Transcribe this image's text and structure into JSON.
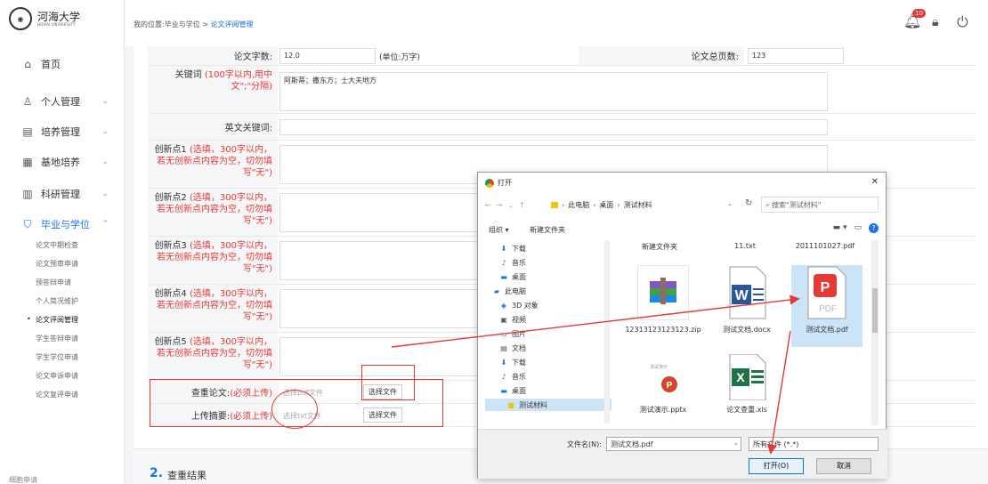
{
  "logo": {
    "name": "河海大学",
    "sub": "HOHAI UNIVERSITY"
  },
  "sidebar": {
    "items": [
      {
        "label": "首页",
        "icon": "home-icon"
      },
      {
        "label": "个人管理",
        "icon": "user-icon"
      },
      {
        "label": "培养管理",
        "icon": "chart-icon"
      },
      {
        "label": "基地培养",
        "icon": "grid-icon"
      },
      {
        "label": "科研管理",
        "icon": "bar-chart-icon"
      },
      {
        "label": "毕业与学位",
        "icon": "graduation-cap-icon"
      }
    ],
    "subitems": [
      "论文中期检查",
      "论文预审申请",
      "预答辩申请",
      "个人简况维护",
      "论文评阅管理",
      "学生答辩申请",
      "学生学位申请",
      "论文申诉申请",
      "论文复评申请"
    ],
    "bottom_text": "细胞申请"
  },
  "header": {
    "breadcrumb_prefix": "我的位置:毕业与学位 >",
    "breadcrumb_current": "论文评阅管理",
    "notification_count": "10"
  },
  "form": {
    "word_count_label": "论文字数:",
    "word_count_value": "12.0",
    "word_count_unit": "(单位:万字)",
    "total_pages_label": "论文总页数:",
    "total_pages_value": "123",
    "keywords_label": "关键词",
    "keywords_hint": "(100字以内,用中文\";\"分隔)",
    "keywords_value": "阿斯蒂；撒东方；士大夫地方",
    "en_keywords_label": "英文关键词:",
    "innovations": [
      {
        "label": "创新点1",
        "hint": "(选填，300字以内，若无创新点内容为空，切勿填写\"无\")"
      },
      {
        "label": "创新点2",
        "hint": "(选填，300字以内，若无创新点内容为空，切勿填写\"无\")"
      },
      {
        "label": "创新点3",
        "hint": "(选填，300字以内，若无创新点内容为空，切勿填写\"无\")"
      },
      {
        "label": "创新点4",
        "hint": "(选填，300字以内，若无创新点内容为空，切勿填写\"无\")"
      },
      {
        "label": "创新点5",
        "hint": "(选填，300字以内，若无创新点内容为空，切勿填写\"无\")"
      }
    ],
    "check_paper_label": "查重论文:",
    "check_paper_req": "(必须上传)",
    "check_paper_placeholder": "选择pdf文件",
    "abstract_label": "上传摘要:",
    "abstract_req": "(必须上传)",
    "abstract_placeholder": "选择txt文件",
    "choose_file": "选择文件"
  },
  "section2": {
    "num": "2.",
    "title": "查重结果"
  },
  "dialog": {
    "title": "打开",
    "address": [
      "此电脑",
      "桌面",
      "测试材料"
    ],
    "search_placeholder": "搜索\"测试材料\"",
    "organize": "组织 ▾",
    "new_folder": "新建文件夹",
    "tree": [
      {
        "label": "下载",
        "icon": "download-icon"
      },
      {
        "label": "音乐",
        "icon": "music-icon"
      },
      {
        "label": "桌面",
        "icon": "desktop-icon"
      },
      {
        "label": "此电脑",
        "icon": "computer-icon"
      },
      {
        "label": "3D 对象",
        "icon": "cube-icon"
      },
      {
        "label": "视频",
        "icon": "video-icon"
      },
      {
        "label": "图片",
        "icon": "picture-icon"
      },
      {
        "label": "文档",
        "icon": "document-icon"
      },
      {
        "label": "下载",
        "icon": "download-icon"
      },
      {
        "label": "音乐",
        "icon": "music-icon"
      },
      {
        "label": "桌面",
        "icon": "desktop-icon"
      },
      {
        "label": "测试材料",
        "icon": "folder-icon"
      }
    ],
    "top_files": [
      "新建文件夹",
      "11.txt",
      "2011101027.pdf"
    ],
    "files": [
      {
        "label": "12313123123123.zip",
        "icon": "zip-archive-icon"
      },
      {
        "label": "测试文档.docx",
        "icon": "word-icon"
      },
      {
        "label": "测试文档.pdf",
        "icon": "pdf-icon"
      },
      {
        "label": "测试演示.pptx",
        "icon": "powerpoint-icon"
      },
      {
        "label": "论文查重.xls",
        "icon": "excel-icon"
      }
    ],
    "filename_label": "文件名(N):",
    "filename_value": "测试文档.pdf",
    "filetype_value": "所有文件 (*.*)",
    "open_label": "打开(O)",
    "cancel_label": "取消"
  }
}
